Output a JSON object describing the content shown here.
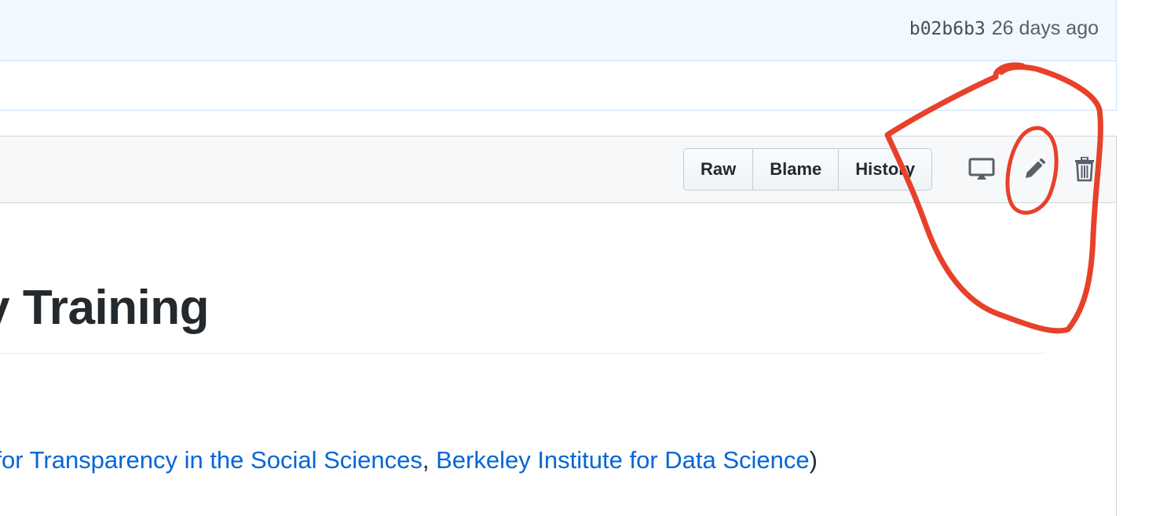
{
  "commit": {
    "sha": "b02b6b3",
    "age": "26 days ago"
  },
  "file_actions": {
    "raw_label": "Raw",
    "blame_label": "Blame",
    "history_label": "History",
    "icons": [
      "desktop-icon",
      "pencil-icon",
      "trash-icon"
    ]
  },
  "readme": {
    "heading_fragment": "ility Training",
    "para_prefix_fragment": "for Transparency in the Social Sciences",
    "para_separator": ", ",
    "para_link2": "Berkeley Institute for Data Science",
    "para_suffix": ")"
  },
  "colors": {
    "link": "#0366d6",
    "annotation": "#e8402a",
    "commit_bg": "#f1f8ff"
  }
}
